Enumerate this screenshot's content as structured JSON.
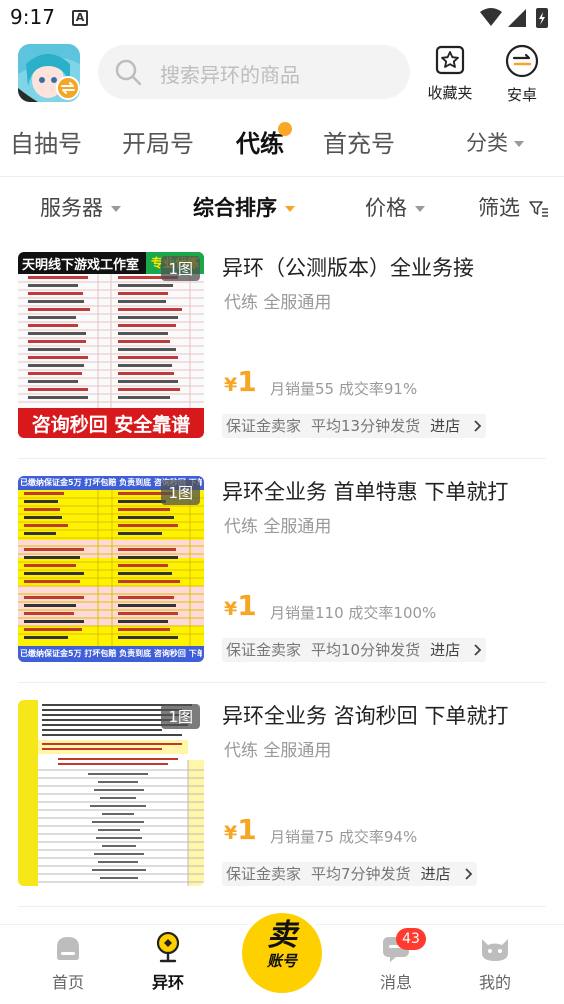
{
  "status_bar": {
    "time": "9:17",
    "notif_icon": "A"
  },
  "header": {
    "search_placeholder": "搜索异环的商品",
    "favorites_label": "收藏夹",
    "android_label": "安卓"
  },
  "tabs": [
    {
      "label": "自抽号"
    },
    {
      "label": "开局号"
    },
    {
      "label": "代练"
    },
    {
      "label": "首充号"
    },
    {
      "label": "分类"
    }
  ],
  "filters": [
    {
      "label": "服务器"
    },
    {
      "label": "综合排序"
    },
    {
      "label": "价格"
    },
    {
      "label": "筛选"
    }
  ],
  "products": [
    {
      "title": "异环（公测版本）全业务接",
      "subtitle": "代练 全服通用",
      "currency": "¥",
      "price": "1",
      "sales": "月销量55 成交率91%",
      "tag1": "保证金卖家",
      "tag2": "平均13分钟发货",
      "store": "进店",
      "badge": "1图",
      "thumb_header": "天明线下游戏工作室",
      "thumb_corner": "专业代练",
      "thumb_footer": "咨询秒回 安全靠谱"
    },
    {
      "title": "异环全业务 首单特惠 下单就打",
      "subtitle": "代练 全服通用",
      "currency": "¥",
      "price": "1",
      "sales": "月销量110 成交率100%",
      "tag1": "保证金卖家",
      "tag2": "平均10分钟发货",
      "store": "进店",
      "badge": "1图",
      "thumb_header": "已缴纳保证金5万 打坏包赔 负责到底 咨询秒回 下单就打",
      "thumb_footer": "已缴纳保证金5万 打坏包赔 负责到底 咨询秒回 下单就打"
    },
    {
      "title": "异环全业务 咨询秒回 下单就打",
      "subtitle": "代练 全服通用",
      "currency": "¥",
      "price": "1",
      "sales": "月销量75 成交率94%",
      "tag1": "保证金卖家",
      "tag2": "平均7分钟发货",
      "store": "进店",
      "badge": "1图"
    }
  ],
  "bottom_nav": {
    "home": "首页",
    "yihuan": "异环",
    "sell_line1": "卖",
    "sell_line2": "账号",
    "messages": "消息",
    "messages_count": "43",
    "mine": "我的"
  },
  "colors": {
    "accent": "#f5a623",
    "sell_yellow": "#ffd000",
    "badge_red": "#ff3b30"
  }
}
